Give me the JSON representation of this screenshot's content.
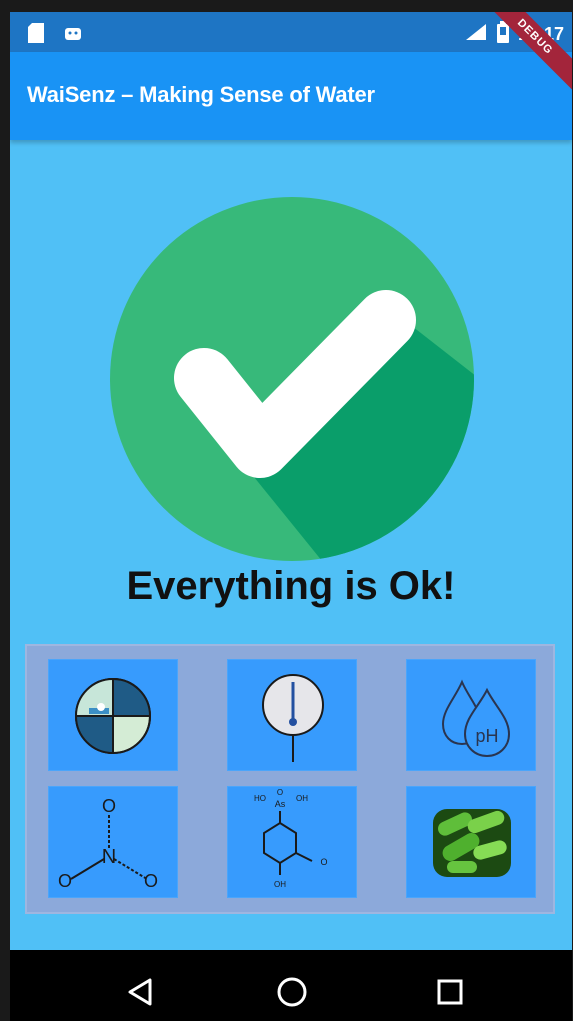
{
  "status_bar": {
    "time": "12:17",
    "left_icons": [
      "sd-card-icon",
      "android-icon"
    ],
    "right_icons": [
      "signal-icon",
      "battery-icon"
    ]
  },
  "app_bar": {
    "title": "WaiSenz – Making Sense of Water",
    "debug_banner": "DEBUG",
    "background": "#1993f5"
  },
  "status": {
    "message": "Everything is Ok!",
    "icon": "check-circle-icon",
    "colors": {
      "circle": "#37b97a",
      "shadow": "#0a9e6a",
      "check": "#ffffff"
    }
  },
  "sensor_tiles": [
    {
      "name": "turbidity",
      "icon": "turbidity-icon"
    },
    {
      "name": "temperature",
      "icon": "thermometer-icon"
    },
    {
      "name": "ph",
      "icon": "ph-drops-icon",
      "label": "pH"
    },
    {
      "name": "nitrate",
      "icon": "nitrate-molecule-icon",
      "label": "N",
      "atom_labels": [
        "O",
        "O",
        "O"
      ]
    },
    {
      "name": "arsenic",
      "icon": "arsenic-molecule-icon",
      "label": "As",
      "atom_labels": [
        "HO",
        "OH",
        "O",
        "O",
        "OH"
      ]
    },
    {
      "name": "bacteria",
      "icon": "bacteria-icon"
    }
  ],
  "nav_bar": {
    "buttons": [
      "back-icon",
      "home-icon",
      "recents-icon"
    ]
  },
  "colors": {
    "page_background": "#50c0f6",
    "status_bar": "#1e75c4",
    "tile": "#379bfd",
    "grid_panel": "#8ca9da"
  }
}
